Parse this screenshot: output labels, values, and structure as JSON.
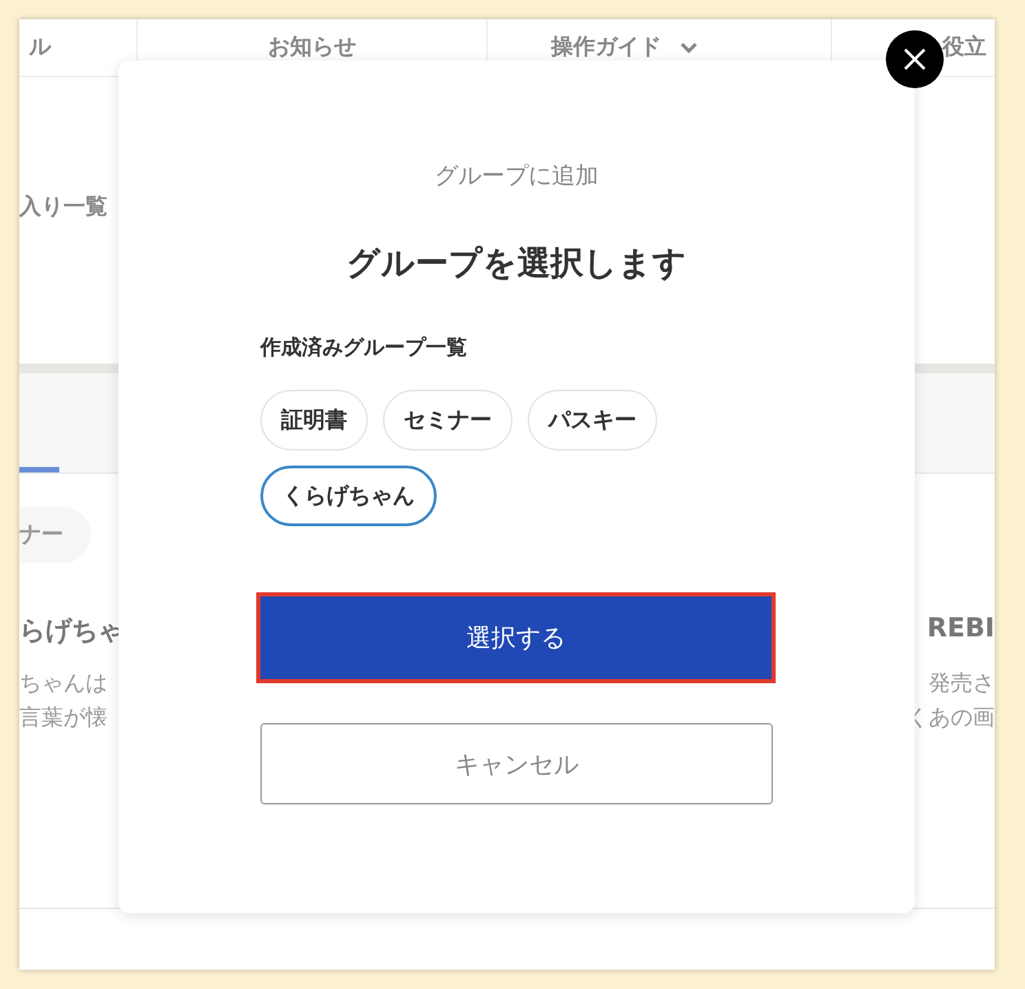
{
  "background_page": {
    "nav": [
      {
        "label": "ル",
        "has_menu": false
      },
      {
        "label": "お知らせ",
        "has_menu": false
      },
      {
        "label": "操作ガイド",
        "has_menu": true
      },
      {
        "label": "役立",
        "has_menu": false
      }
    ],
    "heading_left": "入り一覧",
    "chip_left": "ナー",
    "card_left": {
      "title": "らげちゃ",
      "lines": [
        "ちゃんは",
        "言葉が懐"
      ]
    },
    "card_right": {
      "title": "REBI",
      "lines": [
        "発売さ",
        "くあの画"
      ]
    }
  },
  "modal": {
    "subtitle": "グループに追加",
    "title": "グループを選択します",
    "section_label": "作成済みグループ一覧",
    "groups": [
      {
        "label": "証明書",
        "selected": false
      },
      {
        "label": "セミナー",
        "selected": false
      },
      {
        "label": "パスキー",
        "selected": false
      },
      {
        "label": "くらげちゃん",
        "selected": true
      }
    ],
    "primary_button": {
      "label": "選択する",
      "highlighted": true
    },
    "cancel_button": {
      "label": "キャンセル"
    }
  }
}
